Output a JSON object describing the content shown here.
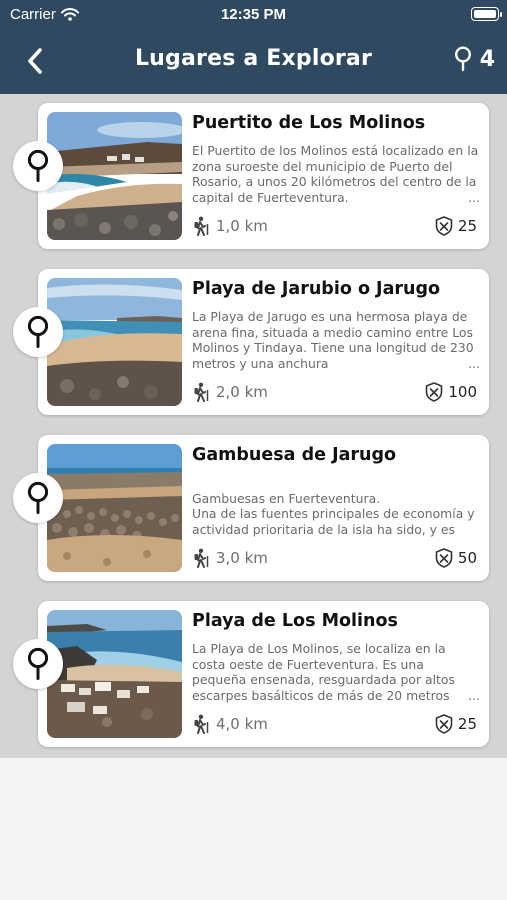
{
  "status": {
    "carrier": "Carrier",
    "time": "12:35 PM"
  },
  "header": {
    "title": "Lugares a Explorar",
    "count": "4"
  },
  "places": [
    {
      "title": "Puertito de Los Molinos",
      "description": "El Puertito de los Molinos está localizado en la zona suroeste del municipio de Puerto del Rosario, a unos 20 kilómetros del centro de la capital de Fuerteventura.",
      "distance": "1,0 km",
      "points": "25"
    },
    {
      "title": "Playa de Jarubio o Jarugo",
      "description": "La Playa de Jarugo es una hermosa playa de arena fina, situada a medio camino entre Los Molinos y  Tindaya. Tiene una longitud de 230 metros y una anchura",
      "distance": "2,0 km",
      "points": "100"
    },
    {
      "title": "Gambuesa de Jarugo",
      "description": "Gambuesas en Fuerteventura.\nUna de las fuentes principales de economía y actividad prioritaria de la isla ha sido, y es actualmente, el pastoreo.",
      "distance": "3,0 km",
      "points": "50"
    },
    {
      "title": "Playa de Los Molinos",
      "description": "La Playa de Los Molinos, se localiza en la costa oeste de Fuerteventura. Es una pequeña ensenada, resguardada por altos escarpes basálticos de más de 20 metros",
      "distance": "4,0 km",
      "points": "25"
    }
  ],
  "icons": {
    "back": "chevron-left-icon",
    "pin": "map-pin-icon",
    "hiker": "hiker-icon",
    "badge": "shield-badge-icon"
  },
  "colors": {
    "header": "#2f4a60",
    "list_background": "#d4d4d4",
    "page_background": "#f3f3f3"
  }
}
